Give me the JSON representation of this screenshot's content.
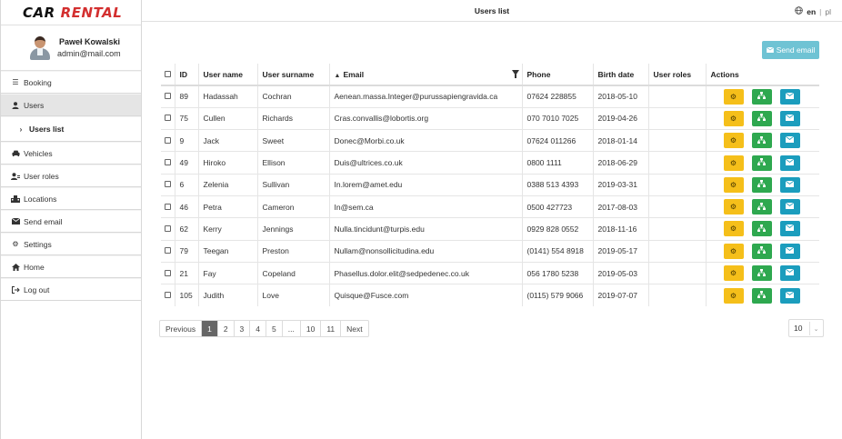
{
  "logo": {
    "car": "CAR",
    "rental": "RENTAL"
  },
  "profile": {
    "name": "Paweł Kowalski",
    "email": "admin@mail.com"
  },
  "sidebar": {
    "items": [
      {
        "label": "Booking",
        "icon": "list-icon"
      },
      {
        "label": "Users",
        "icon": "user-icon"
      },
      {
        "label": "Users list",
        "icon": "chevron-right-icon"
      },
      {
        "label": "Vehicles",
        "icon": "car-icon"
      },
      {
        "label": "User roles",
        "icon": "user-roles-icon"
      },
      {
        "label": "Locations",
        "icon": "locations-icon"
      },
      {
        "label": "Send email",
        "icon": "envelope-icon"
      },
      {
        "label": "Settings",
        "icon": "gear-icon"
      },
      {
        "label": "Home",
        "icon": "home-icon"
      },
      {
        "label": "Log out",
        "icon": "logout-icon"
      }
    ]
  },
  "header": {
    "title": "Users list",
    "lang_active": "en",
    "lang_sep": "|",
    "lang_other": "pl"
  },
  "toolbar": {
    "send_email": "Send email"
  },
  "table": {
    "columns": [
      "ID",
      "User name",
      "User surname",
      "Email",
      "Phone",
      "Birth date",
      "User roles",
      "Actions"
    ],
    "rows": [
      [
        "89",
        "Hadassah",
        "Cochran",
        "Aenean.massa.Integer@purussapiengravida.ca",
        "07624 228855",
        "2018-05-10",
        ""
      ],
      [
        "75",
        "Cullen",
        "Richards",
        "Cras.convallis@lobortis.org",
        "070 7010 7025",
        "2019-04-26",
        ""
      ],
      [
        "9",
        "Jack",
        "Sweet",
        "Donec@Morbi.co.uk",
        "07624 011266",
        "2018-01-14",
        ""
      ],
      [
        "49",
        "Hiroko",
        "Ellison",
        "Duis@ultrices.co.uk",
        "0800 1111",
        "2018-06-29",
        ""
      ],
      [
        "6",
        "Zelenia",
        "Sullivan",
        "In.lorem@amet.edu",
        "0388 513 4393",
        "2019-03-31",
        ""
      ],
      [
        "46",
        "Petra",
        "Cameron",
        "In@sem.ca",
        "0500 427723",
        "2017-08-03",
        ""
      ],
      [
        "62",
        "Kerry",
        "Jennings",
        "Nulla.tincidunt@turpis.edu",
        "0929 828 0552",
        "2018-11-16",
        ""
      ],
      [
        "79",
        "Teegan",
        "Preston",
        "Nullam@nonsollicitudina.edu",
        "(0141) 554 8918",
        "2019-05-17",
        ""
      ],
      [
        "21",
        "Fay",
        "Copeland",
        "Phasellus.dolor.elit@sedpedenec.co.uk",
        "056 1780 5238",
        "2019-05-03",
        ""
      ],
      [
        "105",
        "Judith",
        "Love",
        "Quisque@Fusce.com",
        "(0115) 579 9066",
        "2019-07-07",
        ""
      ]
    ]
  },
  "pagination": {
    "pages": [
      "Previous",
      "1",
      "2",
      "3",
      "4",
      "5",
      "...",
      "10",
      "11",
      "Next"
    ],
    "active": "1"
  },
  "page_size": "10",
  "colors": {
    "accent_red": "#d32f2f",
    "edit": "#f5bf1a",
    "roles": "#2ea84f",
    "mail": "#1b9dbd",
    "send_btn": "#6fc3d4"
  }
}
